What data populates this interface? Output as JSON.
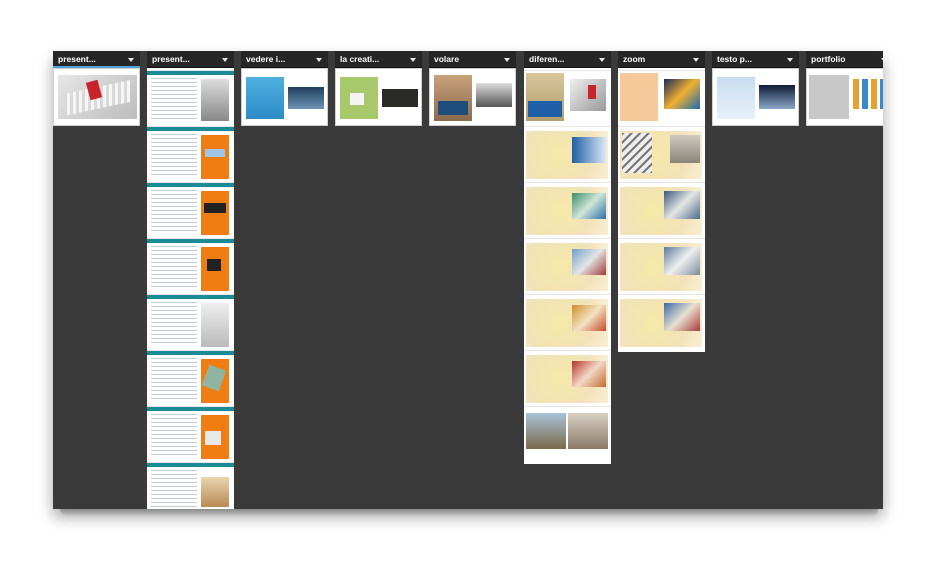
{
  "columns": [
    {
      "label": "present...",
      "icon": "chevron-down-icon"
    },
    {
      "label": "present...",
      "icon": "chevron-down-icon"
    },
    {
      "label": "vedere i...",
      "icon": "chevron-down-icon"
    },
    {
      "label": "la creati...",
      "icon": "chevron-down-icon"
    },
    {
      "label": "volare",
      "icon": "chevron-down-icon"
    },
    {
      "label": "diferen...",
      "icon": "chevron-down-icon"
    },
    {
      "label": "zoom",
      "icon": "chevron-down-icon"
    },
    {
      "label": "testo p...",
      "icon": "chevron-down-icon"
    },
    {
      "label": "portfolio",
      "icon": "chevron-down-icon"
    }
  ],
  "colors": {
    "board": "#3a3a3a",
    "header": "#262626",
    "accent_teal": "#1a8a93",
    "accent_orange": "#f07d12"
  }
}
